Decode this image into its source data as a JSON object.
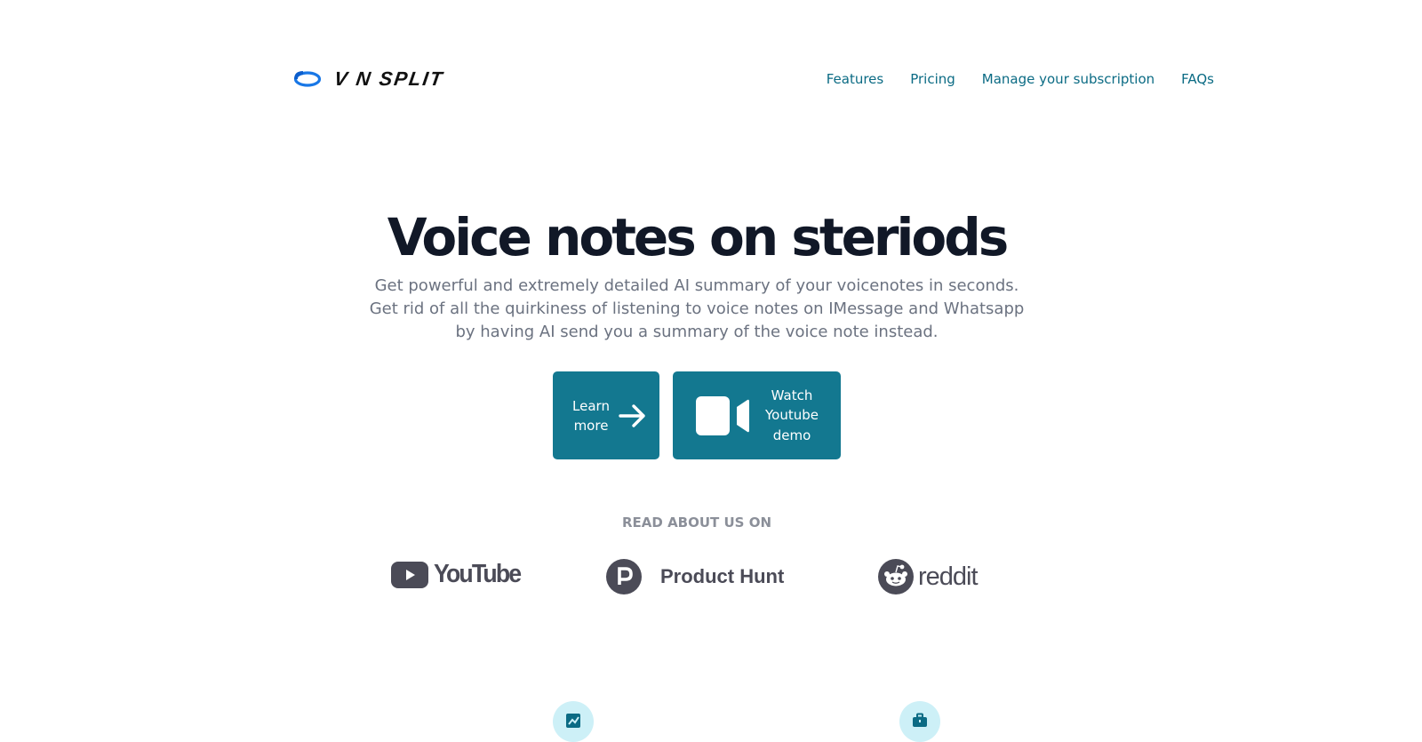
{
  "brand": {
    "name": "V N SPLIT",
    "accent": "#1877e6"
  },
  "nav": {
    "items": [
      {
        "label": "Features"
      },
      {
        "label": "Pricing"
      },
      {
        "label": "Manage your subscription"
      },
      {
        "label": "FAQs"
      }
    ],
    "color": "#0b6b84"
  },
  "hero": {
    "title": "Voice notes on steriods",
    "subtitle": "Get powerful and extremely detailed AI summary of your voicenotes in seconds. Get rid of all the quirkiness of listening to voice notes on IMessage and Whatsapp by having AI send you a summary of the voice note instead.",
    "learn_more_label": "Learn more",
    "watch_demo_label": "Watch Youtube demo",
    "button_color": "#137890"
  },
  "social": {
    "label": "READ ABOUT US ON",
    "brands": [
      {
        "name": "YouTube",
        "icon": "youtube-icon"
      },
      {
        "name": "Product Hunt",
        "icon": "product-hunt-icon"
      },
      {
        "name": "reddit",
        "icon": "reddit-icon"
      }
    ]
  },
  "features": {
    "icons": [
      "chart-icon",
      "briefcase-icon"
    ],
    "icon_bg": "#cdf0f7"
  }
}
